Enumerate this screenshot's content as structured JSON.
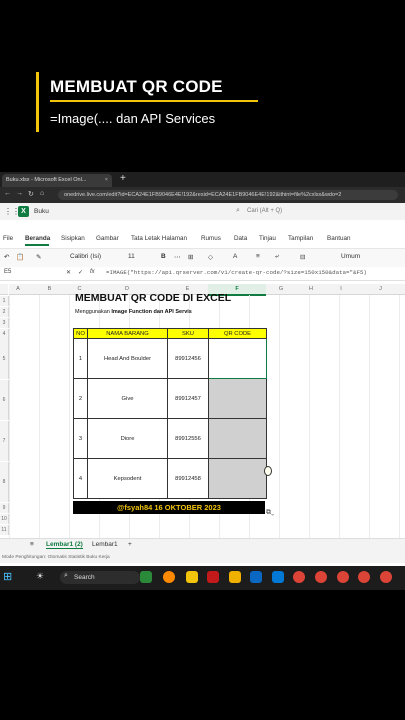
{
  "overlay": {
    "title": "MEMBUAT QR CODE",
    "subtitle": "=Image(.... dan API Services"
  },
  "browser": {
    "tab_title": "Buku.xlsx - Microsoft Excel Onl...",
    "tab_close": "×",
    "new_tab": "+",
    "url": "onedrive.live.com/edit?id=ECA24E1FB9046E4E!192&resid=ECA24E1FB9046E4E!192&ithint=file%2cxlsx&wdo=2"
  },
  "app": {
    "file_name": "Buku",
    "search_placeholder": "Cari (Alt + Q)"
  },
  "menu": [
    "File",
    "Beranda",
    "Sisipkan",
    "Gambar",
    "Tata Letak Halaman",
    "Rumus",
    "Data",
    "Tinjau",
    "Tampilan",
    "Bantuan"
  ],
  "ribbon": {
    "font": "Calibri (Isi)",
    "size": "11",
    "number_format": "Umum"
  },
  "formula_bar": {
    "cell": "E5",
    "formula": "=IMAGE(\"https://api.qrserver.com/v1/create-qr-code/?size=150x150&data=\"&F5)"
  },
  "columns": [
    "A",
    "B",
    "C",
    "D",
    "E",
    "F",
    "G",
    "H",
    "I",
    "J"
  ],
  "rows": [
    "1",
    "2",
    "3",
    "4",
    "5",
    "6",
    "7",
    "8",
    "9",
    "10",
    "11"
  ],
  "sheet": {
    "title": "MEMBUAT QR CODE DI EXCEL",
    "sub_prefix": "Menggunakan ",
    "sub_bold": "Image Function dan API Servis",
    "headers": [
      "NO",
      "NAMA BARANG",
      "SKU",
      "QR CODE"
    ],
    "rows": [
      {
        "no": "1",
        "nama": "Head And Boulder",
        "sku": "89912456"
      },
      {
        "no": "2",
        "nama": "Give",
        "sku": "89912457"
      },
      {
        "no": "3",
        "nama": "Diore",
        "sku": "89912556"
      },
      {
        "no": "4",
        "nama": "Kepsodent",
        "sku": "89912458"
      }
    ],
    "footer": "@fsyah84 16 OKTOBER 2023"
  },
  "sheet_tabs": [
    "Lembar1 (2)",
    "Lembar1"
  ],
  "add_sheet": "+",
  "status_bar": "Mode Penghitungan: Otomatis    Statistik Buku Kerja",
  "taskbar": {
    "search_label": "Search"
  }
}
